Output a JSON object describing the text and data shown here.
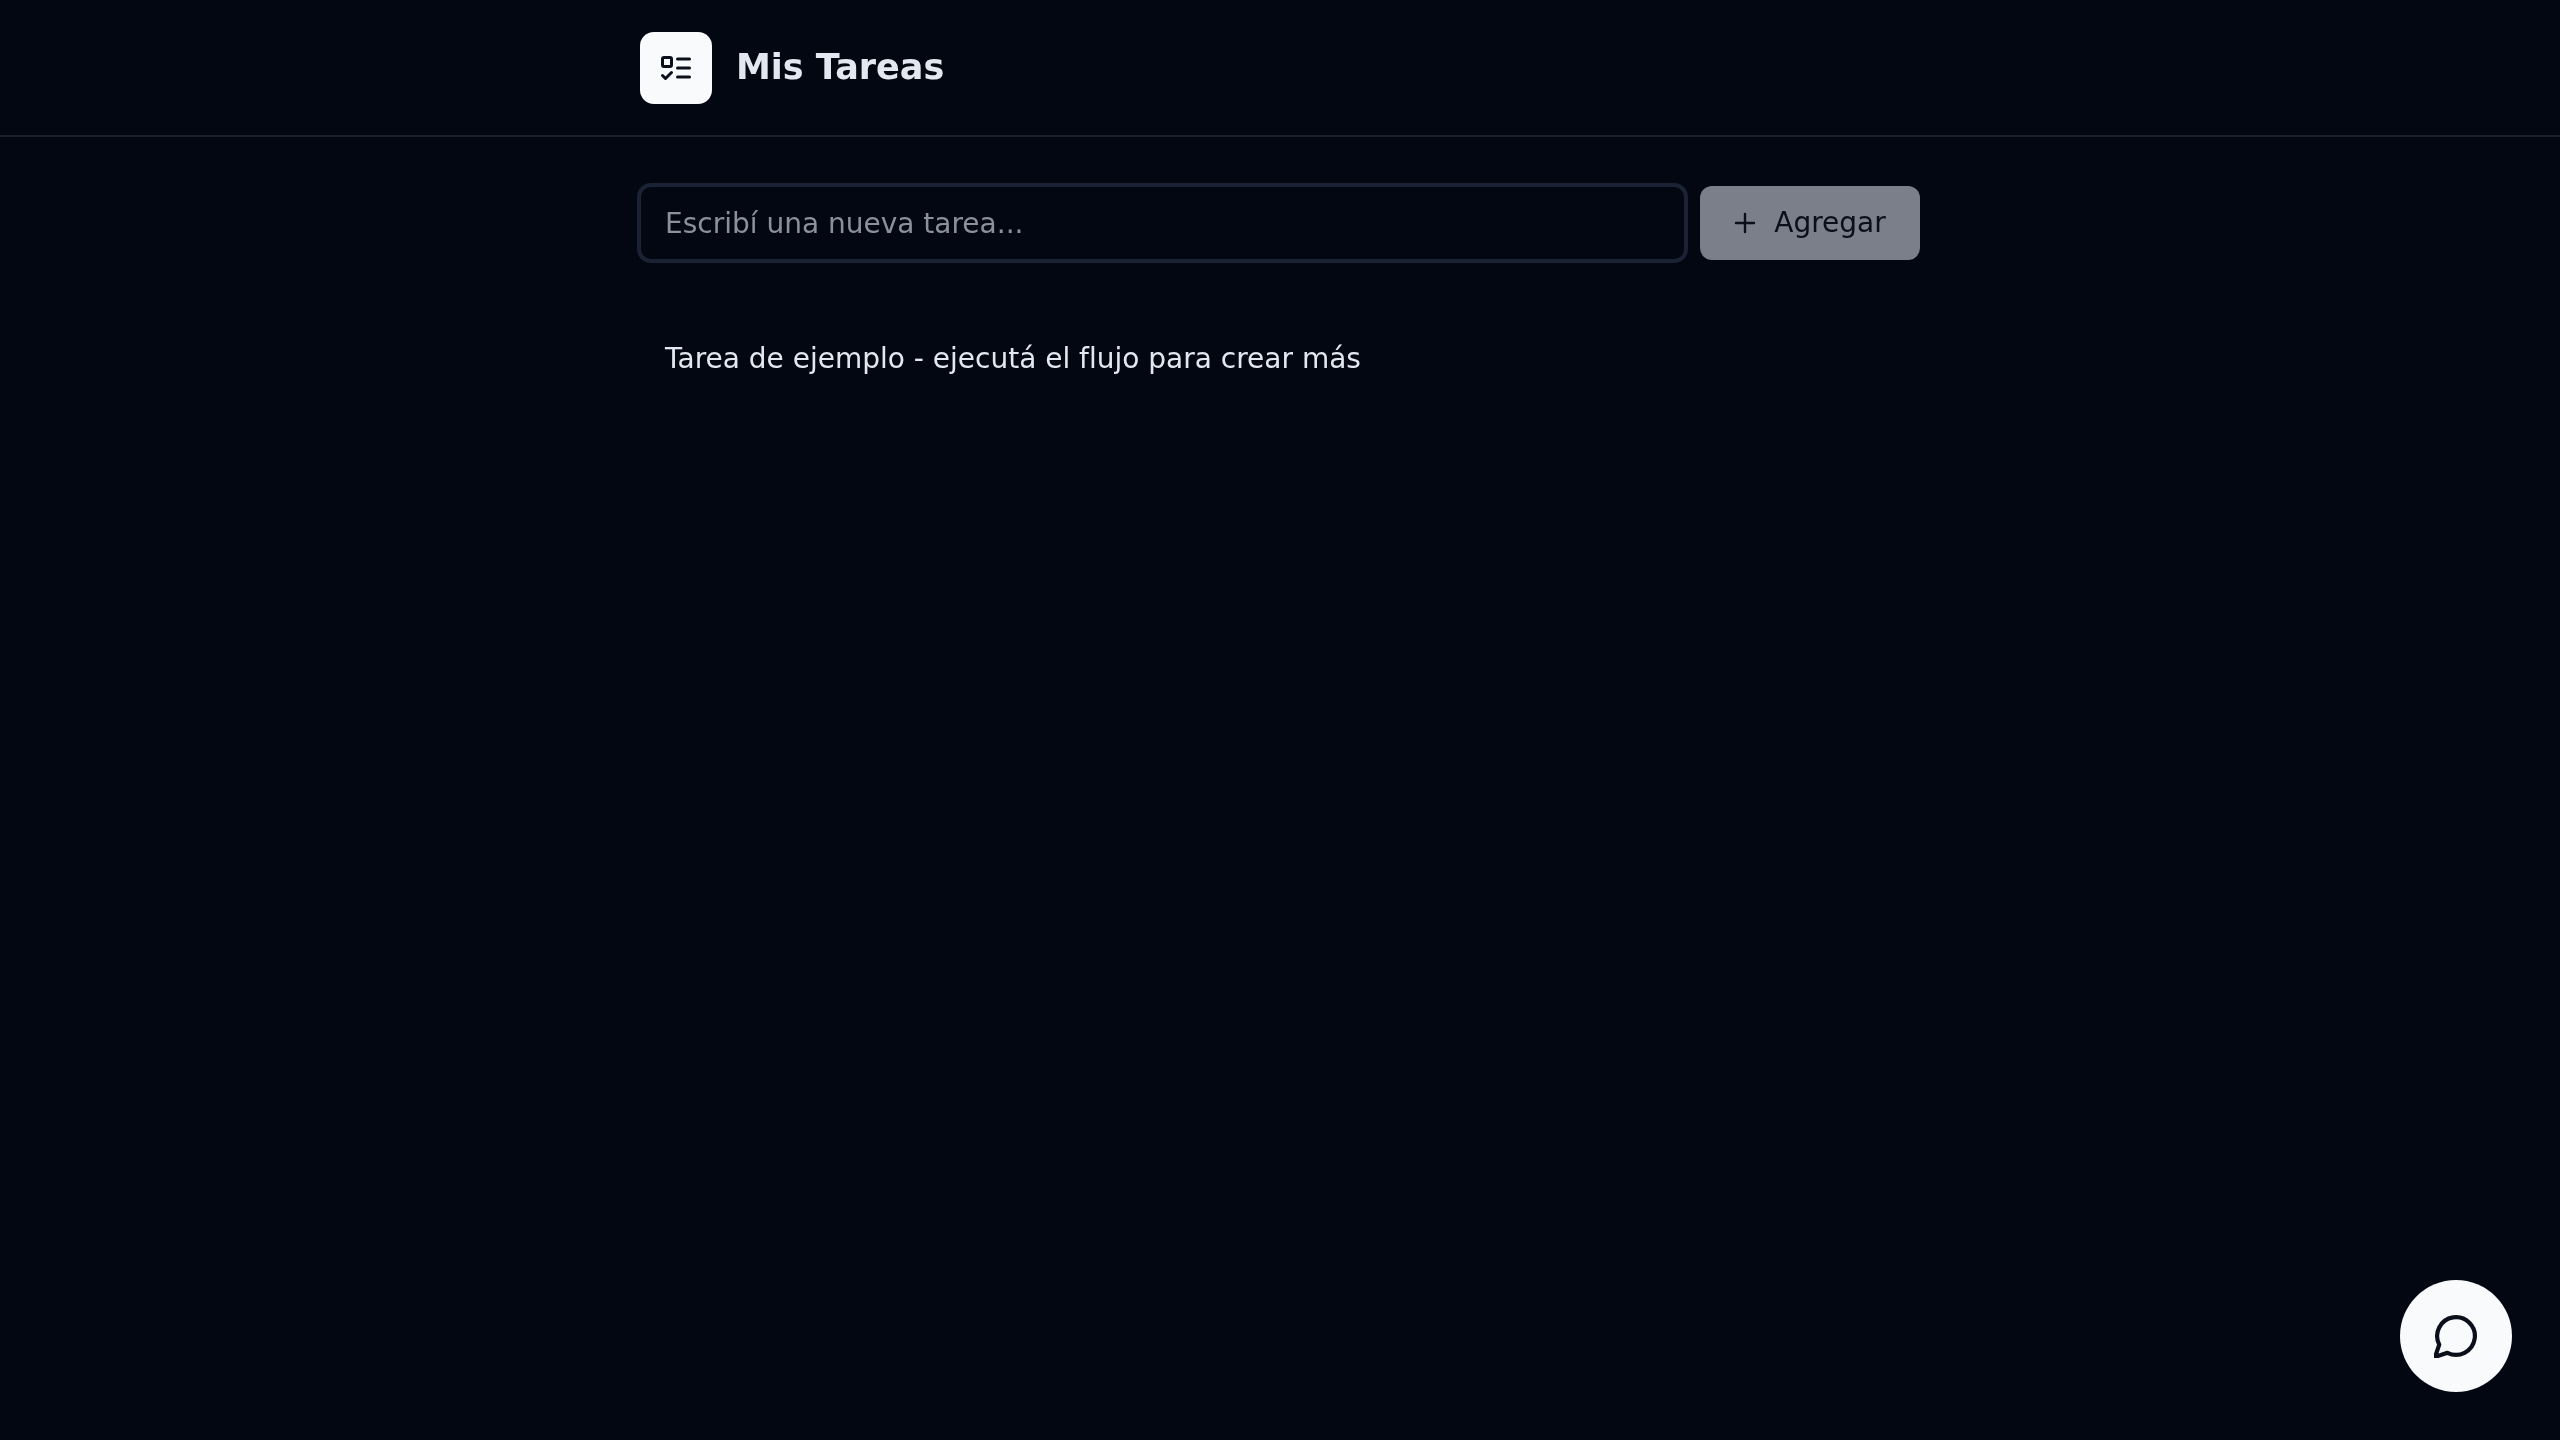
{
  "header": {
    "title": "Mis Tareas"
  },
  "new_task": {
    "placeholder": "Escribí una nueva tarea...",
    "button": {
      "label": "Agregar",
      "disabled": true
    }
  },
  "tasks": [
    {
      "text": "Tarea de ejemplo - ejecutá el flujo para crear más"
    }
  ]
}
